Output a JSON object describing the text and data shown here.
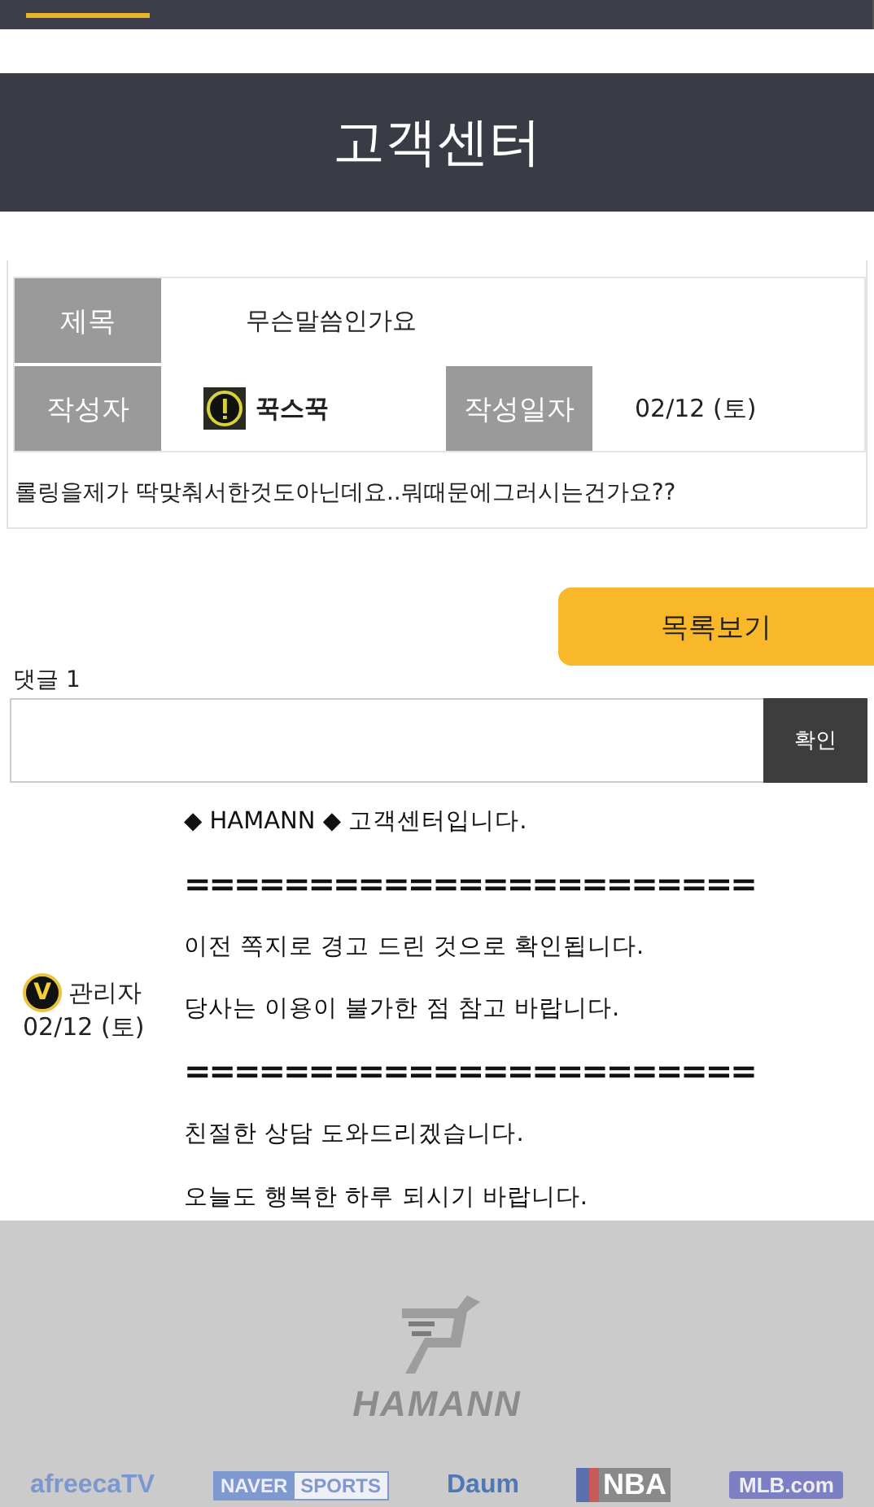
{
  "page_title": "고객센터",
  "post": {
    "fields": [
      {
        "label": "제목",
        "value": "무슨말씀인가요",
        "kind": "text"
      },
      {
        "label": "작성자",
        "value": "꾹스꾹",
        "kind": "author"
      },
      {
        "label": "작성일자",
        "value": "02/12 (토)",
        "kind": "text"
      }
    ],
    "body": "롤링을제가 딱맞춰서한것도아닌데요..뭐때문에그러시는건가요??"
  },
  "list_button": "목록보기",
  "comments": {
    "label": "댓글 1",
    "confirm_button": "확인",
    "items": [
      {
        "badge": "V",
        "author": "관리자",
        "date": "02/12 (토)",
        "lines": [
          "◆ HAMANN ◆ 고객센터입니다.",
          "=======================",
          "이전 쪽지로 경고 드린 것으로 확인됩니다.",
          "당사는 이용이 불가한 점 참고 바랍니다.",
          "=======================",
          "친절한 상담 도와드리겠습니다.",
          "오늘도 행복한 하루 되시기 바랍니다."
        ]
      }
    ]
  },
  "footer": {
    "brand": "HAMANN",
    "partners": [
      {
        "kind": "afreeca",
        "name": "afreecaTV"
      },
      {
        "kind": "naver",
        "name": "NAVER",
        "sub": "SPORTS"
      },
      {
        "kind": "daum",
        "name": "Daum"
      },
      {
        "kind": "nba",
        "name": "NBA"
      },
      {
        "kind": "mlb",
        "name": "MLB.com"
      }
    ]
  }
}
